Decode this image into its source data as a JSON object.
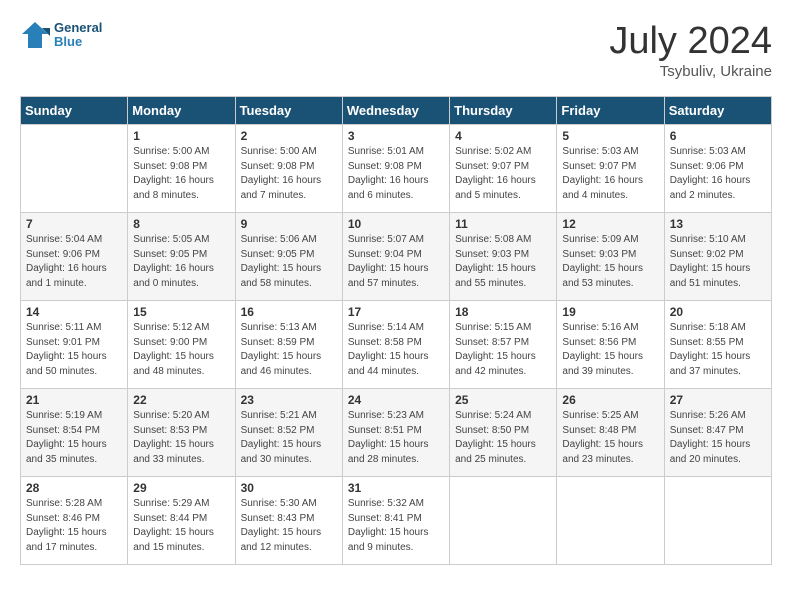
{
  "header": {
    "logo_line1": "General",
    "logo_line2": "Blue",
    "title": "July 2024",
    "subtitle": "Tsybuliv, Ukraine"
  },
  "columns": [
    "Sunday",
    "Monday",
    "Tuesday",
    "Wednesday",
    "Thursday",
    "Friday",
    "Saturday"
  ],
  "weeks": [
    [
      {
        "day": "",
        "info": ""
      },
      {
        "day": "1",
        "info": "Sunrise: 5:00 AM\nSunset: 9:08 PM\nDaylight: 16 hours\nand 8 minutes."
      },
      {
        "day": "2",
        "info": "Sunrise: 5:00 AM\nSunset: 9:08 PM\nDaylight: 16 hours\nand 7 minutes."
      },
      {
        "day": "3",
        "info": "Sunrise: 5:01 AM\nSunset: 9:08 PM\nDaylight: 16 hours\nand 6 minutes."
      },
      {
        "day": "4",
        "info": "Sunrise: 5:02 AM\nSunset: 9:07 PM\nDaylight: 16 hours\nand 5 minutes."
      },
      {
        "day": "5",
        "info": "Sunrise: 5:03 AM\nSunset: 9:07 PM\nDaylight: 16 hours\nand 4 minutes."
      },
      {
        "day": "6",
        "info": "Sunrise: 5:03 AM\nSunset: 9:06 PM\nDaylight: 16 hours\nand 2 minutes."
      }
    ],
    [
      {
        "day": "7",
        "info": "Sunrise: 5:04 AM\nSunset: 9:06 PM\nDaylight: 16 hours\nand 1 minute."
      },
      {
        "day": "8",
        "info": "Sunrise: 5:05 AM\nSunset: 9:05 PM\nDaylight: 16 hours\nand 0 minutes."
      },
      {
        "day": "9",
        "info": "Sunrise: 5:06 AM\nSunset: 9:05 PM\nDaylight: 15 hours\nand 58 minutes."
      },
      {
        "day": "10",
        "info": "Sunrise: 5:07 AM\nSunset: 9:04 PM\nDaylight: 15 hours\nand 57 minutes."
      },
      {
        "day": "11",
        "info": "Sunrise: 5:08 AM\nSunset: 9:03 PM\nDaylight: 15 hours\nand 55 minutes."
      },
      {
        "day": "12",
        "info": "Sunrise: 5:09 AM\nSunset: 9:03 PM\nDaylight: 15 hours\nand 53 minutes."
      },
      {
        "day": "13",
        "info": "Sunrise: 5:10 AM\nSunset: 9:02 PM\nDaylight: 15 hours\nand 51 minutes."
      }
    ],
    [
      {
        "day": "14",
        "info": "Sunrise: 5:11 AM\nSunset: 9:01 PM\nDaylight: 15 hours\nand 50 minutes."
      },
      {
        "day": "15",
        "info": "Sunrise: 5:12 AM\nSunset: 9:00 PM\nDaylight: 15 hours\nand 48 minutes."
      },
      {
        "day": "16",
        "info": "Sunrise: 5:13 AM\nSunset: 8:59 PM\nDaylight: 15 hours\nand 46 minutes."
      },
      {
        "day": "17",
        "info": "Sunrise: 5:14 AM\nSunset: 8:58 PM\nDaylight: 15 hours\nand 44 minutes."
      },
      {
        "day": "18",
        "info": "Sunrise: 5:15 AM\nSunset: 8:57 PM\nDaylight: 15 hours\nand 42 minutes."
      },
      {
        "day": "19",
        "info": "Sunrise: 5:16 AM\nSunset: 8:56 PM\nDaylight: 15 hours\nand 39 minutes."
      },
      {
        "day": "20",
        "info": "Sunrise: 5:18 AM\nSunset: 8:55 PM\nDaylight: 15 hours\nand 37 minutes."
      }
    ],
    [
      {
        "day": "21",
        "info": "Sunrise: 5:19 AM\nSunset: 8:54 PM\nDaylight: 15 hours\nand 35 minutes."
      },
      {
        "day": "22",
        "info": "Sunrise: 5:20 AM\nSunset: 8:53 PM\nDaylight: 15 hours\nand 33 minutes."
      },
      {
        "day": "23",
        "info": "Sunrise: 5:21 AM\nSunset: 8:52 PM\nDaylight: 15 hours\nand 30 minutes."
      },
      {
        "day": "24",
        "info": "Sunrise: 5:23 AM\nSunset: 8:51 PM\nDaylight: 15 hours\nand 28 minutes."
      },
      {
        "day": "25",
        "info": "Sunrise: 5:24 AM\nSunset: 8:50 PM\nDaylight: 15 hours\nand 25 minutes."
      },
      {
        "day": "26",
        "info": "Sunrise: 5:25 AM\nSunset: 8:48 PM\nDaylight: 15 hours\nand 23 minutes."
      },
      {
        "day": "27",
        "info": "Sunrise: 5:26 AM\nSunset: 8:47 PM\nDaylight: 15 hours\nand 20 minutes."
      }
    ],
    [
      {
        "day": "28",
        "info": "Sunrise: 5:28 AM\nSunset: 8:46 PM\nDaylight: 15 hours\nand 17 minutes."
      },
      {
        "day": "29",
        "info": "Sunrise: 5:29 AM\nSunset: 8:44 PM\nDaylight: 15 hours\nand 15 minutes."
      },
      {
        "day": "30",
        "info": "Sunrise: 5:30 AM\nSunset: 8:43 PM\nDaylight: 15 hours\nand 12 minutes."
      },
      {
        "day": "31",
        "info": "Sunrise: 5:32 AM\nSunset: 8:41 PM\nDaylight: 15 hours\nand 9 minutes."
      },
      {
        "day": "",
        "info": ""
      },
      {
        "day": "",
        "info": ""
      },
      {
        "day": "",
        "info": ""
      }
    ]
  ]
}
